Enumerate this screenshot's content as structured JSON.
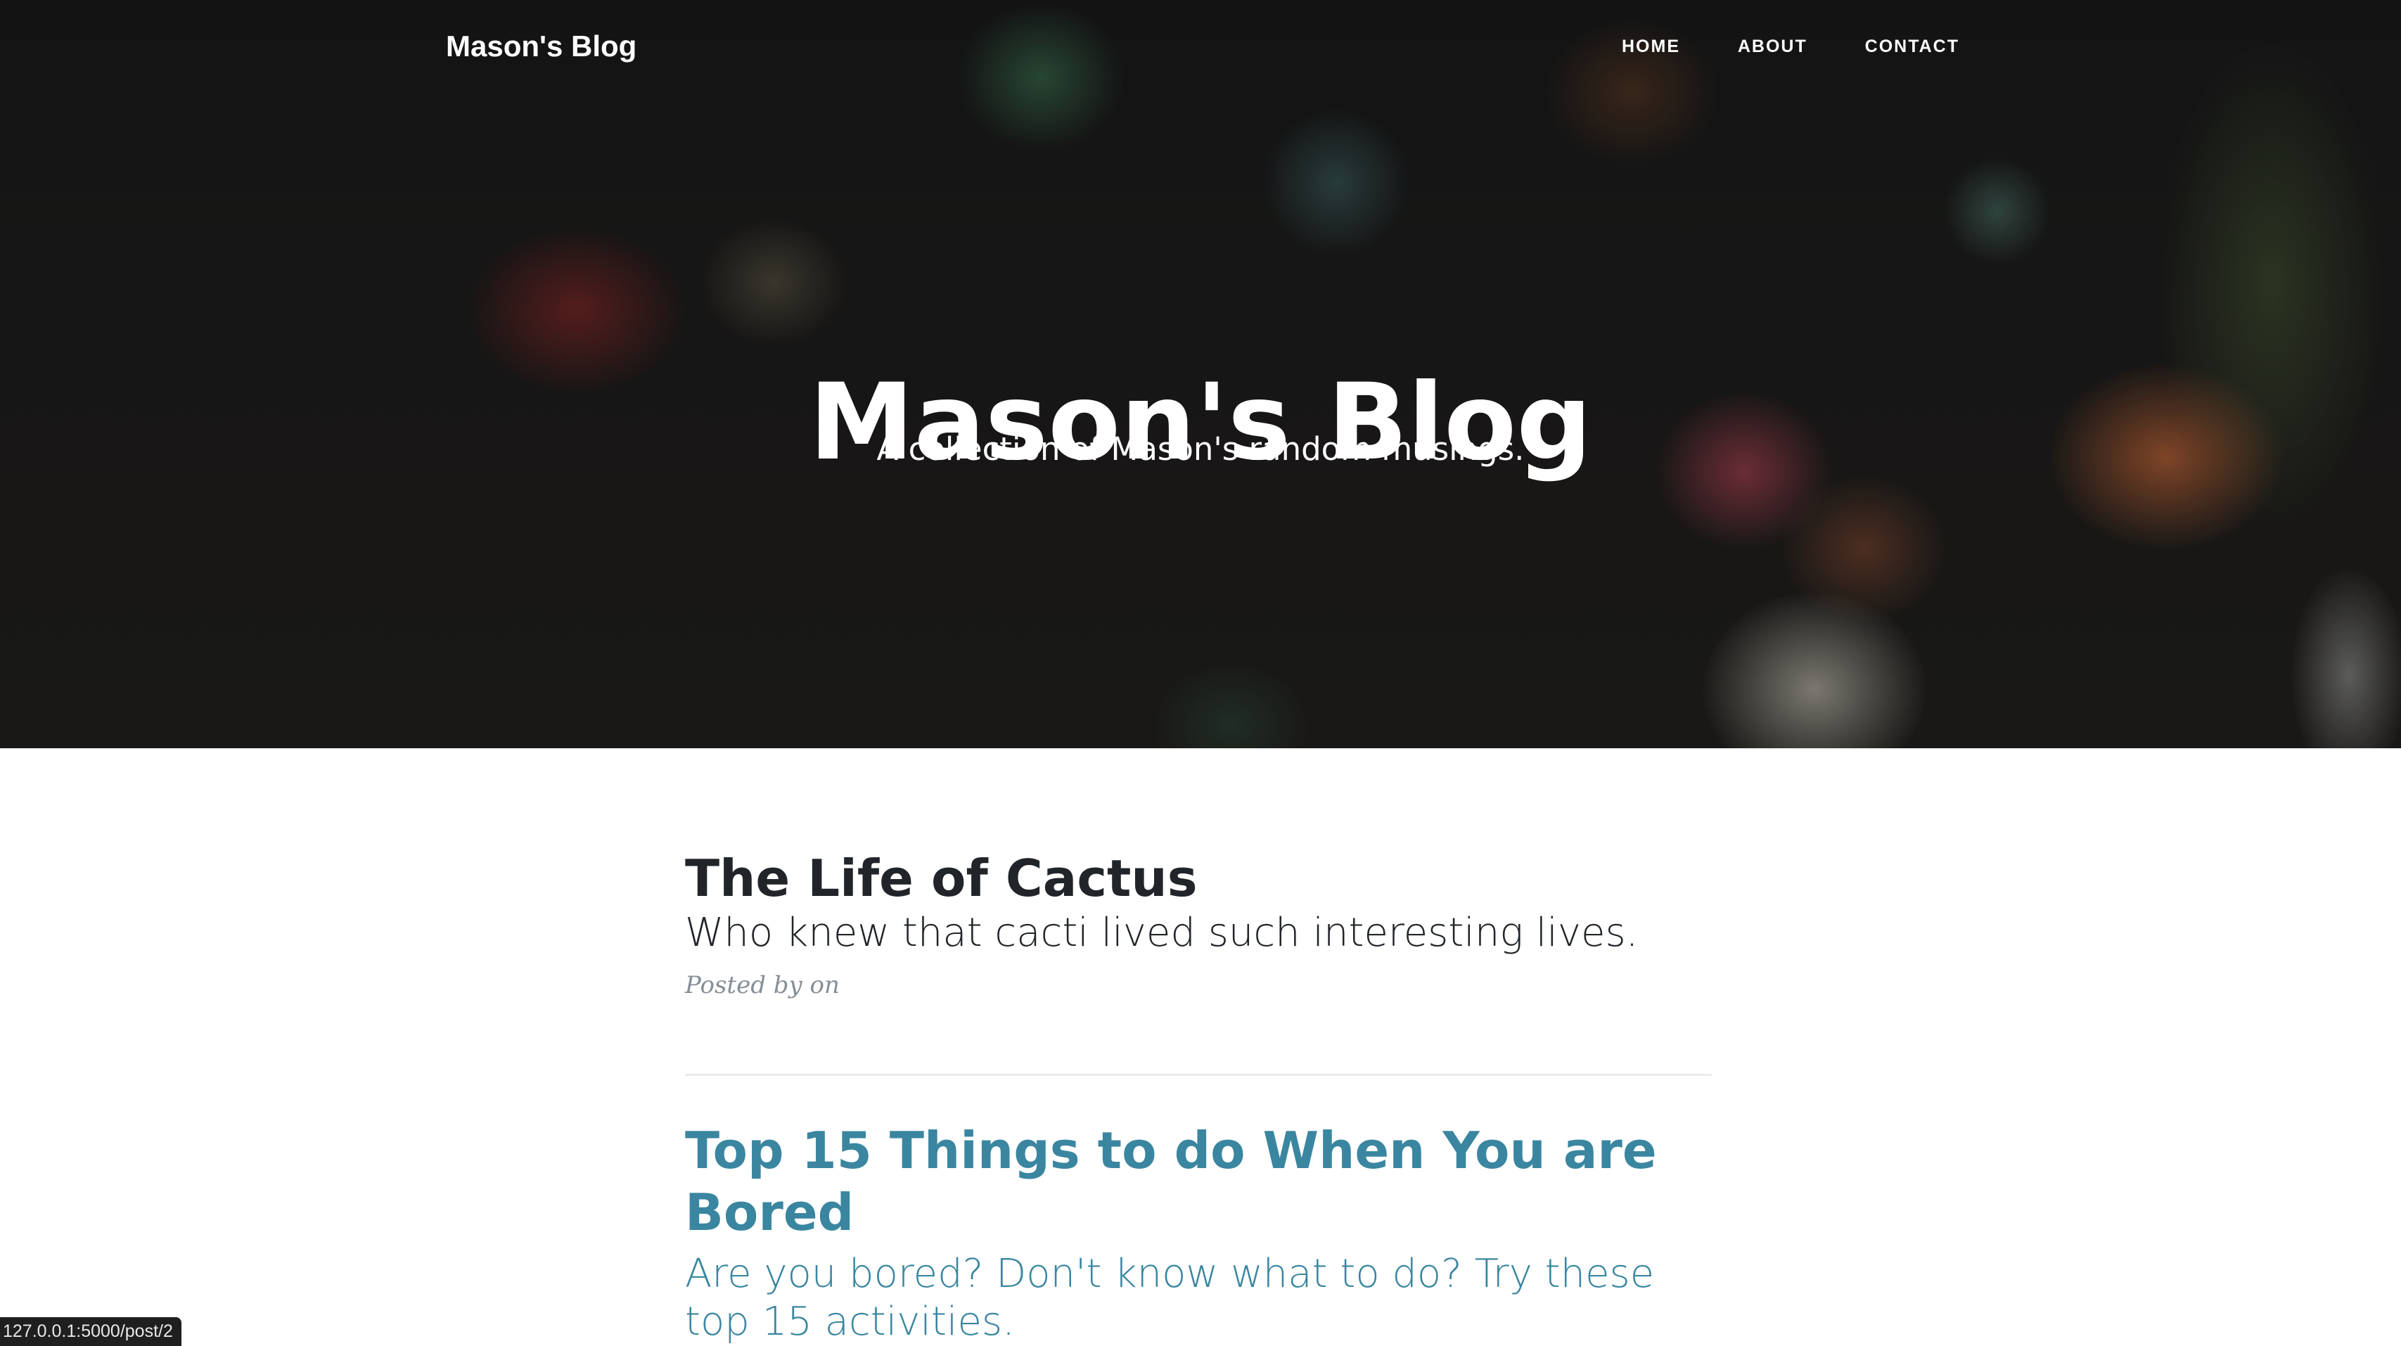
{
  "header": {
    "brand": "Mason's Blog",
    "nav": [
      {
        "label": "HOME"
      },
      {
        "label": "ABOUT"
      },
      {
        "label": "CONTACT"
      }
    ],
    "title": "Mason's Blog",
    "subtitle": "A collection of Mason's random musings."
  },
  "posts": [
    {
      "title": "The Life of Cactus",
      "subtitle": "Who knew that cacti lived such interesting lives.",
      "meta": "Posted by on"
    },
    {
      "title": "Top 15 Things to do When You are Bored",
      "subtitle": "Are you bored? Don't know what to do? Try these top 15 activities."
    }
  ],
  "status_bar": {
    "url": "127.0.0.1:5000/post/2"
  },
  "colors": {
    "text_dark": "#212529",
    "link_hover": "#3a86a0",
    "meta": "#868e96"
  }
}
